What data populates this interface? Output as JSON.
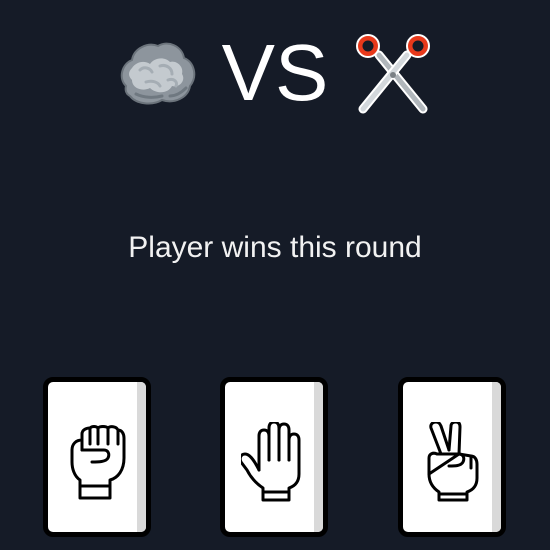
{
  "header": {
    "player_choice_icon": "rock-icon",
    "vs_label": "VS",
    "opponent_choice_icon": "scissors-icon"
  },
  "result": {
    "message": "Player wins this round"
  },
  "cards": [
    {
      "name": "rock",
      "icon": "fist-icon"
    },
    {
      "name": "paper",
      "icon": "open-hand-icon"
    },
    {
      "name": "scissors",
      "icon": "peace-hand-icon"
    }
  ],
  "colors": {
    "background": "#151b27",
    "text": "#ffffff",
    "card_background": "#ffffff",
    "card_border": "#000000",
    "scissors_handle": "#e8391b"
  }
}
